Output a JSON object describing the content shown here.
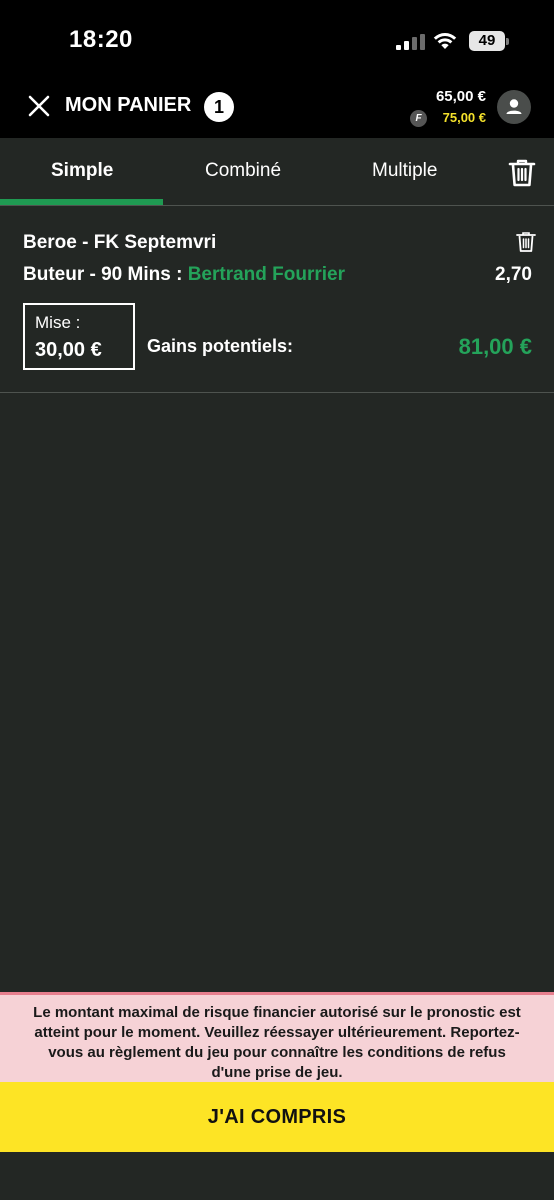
{
  "status_bar": {
    "time": "18:20",
    "battery": "49"
  },
  "header": {
    "title": "MON PANIER",
    "count": "1",
    "balance_main": "65,00 €",
    "balance_bonus": "75,00 €",
    "bonus_icon_letter": "F"
  },
  "tabs": [
    {
      "label": "Simple",
      "active": true
    },
    {
      "label": "Combiné",
      "active": false
    },
    {
      "label": "Multiple",
      "active": false
    }
  ],
  "bet": {
    "match": "Beroe - FK Septemvri",
    "market": "Buteur - 90 Mins : ",
    "selection": "Bertrand Fourrier",
    "odds": "2,70",
    "stake_label": "Mise :",
    "stake_value": "30,00 €",
    "gains_label": "Gains potentiels:",
    "gains_value": "81,00 €"
  },
  "alert": {
    "message": "Le montant maximal de risque financier autorisé sur le pronostic est atteint pour le moment. Veuillez réessayer ultérieurement. Reportez-vous au règlement du jeu pour connaître les conditions de refus d'une prise de jeu."
  },
  "cta": {
    "label": "J'AI COMPRIS"
  },
  "colors": {
    "accent_green": "#24a35a",
    "tab_underline": "#1f9a52",
    "cta_yellow": "#fde425",
    "alert_pink": "#f6d2d6",
    "bonus_yellow": "#f4e12b",
    "background": "#232724"
  },
  "icons": [
    "close-icon",
    "trash-icon",
    "user-icon",
    "signal-icon",
    "wifi-icon",
    "battery-icon"
  ]
}
